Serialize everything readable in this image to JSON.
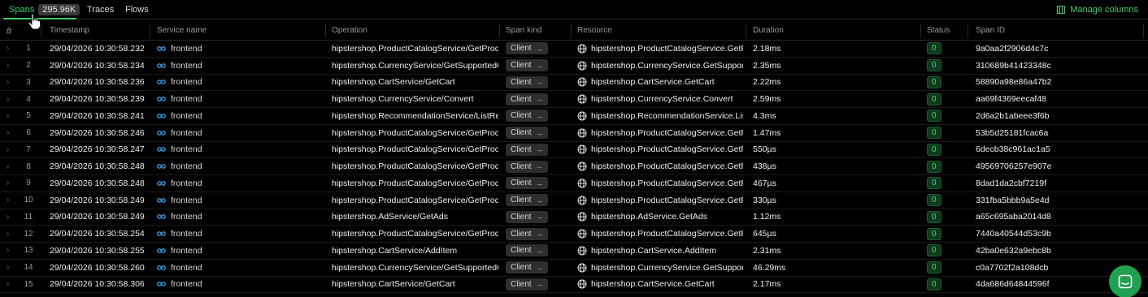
{
  "tabs": [
    {
      "label": "Spans",
      "count": "295.96K",
      "active": true
    },
    {
      "label": "Traces"
    },
    {
      "label": "Flows"
    }
  ],
  "manage_columns": "Manage columns",
  "columns": {
    "num": "#",
    "timestamp": "Timestamp",
    "service": "Service name",
    "operation": "Operation",
    "kind": "Span kind",
    "resource": "Resource",
    "duration": "Duration",
    "status": "Status",
    "span_id": "Span ID"
  },
  "rows": [
    {
      "n": "1",
      "ts": "29/04/2026 10:30:58.232",
      "svc": "frontend",
      "op": "hipstershop.ProductCatalogService/GetProdu…",
      "kind": "Client",
      "res": "hipstershop.ProductCatalogService.GetProd",
      "dur": "2.18ms",
      "status": "0",
      "id": "9a0aa2f2906d4c7c"
    },
    {
      "n": "2",
      "ts": "29/04/2026 10:30:58.234",
      "svc": "frontend",
      "op": "hipstershop.CurrencyService/GetSupportedC…",
      "kind": "Client",
      "res": "hipstershop.CurrencyService.GetSupported",
      "dur": "2.35ms",
      "status": "0",
      "id": "310689b41423348c"
    },
    {
      "n": "3",
      "ts": "29/04/2026 10:30:58.236",
      "svc": "frontend",
      "op": "hipstershop.CartService/GetCart",
      "kind": "Client",
      "res": "hipstershop.CartService.GetCart",
      "dur": "2.22ms",
      "status": "0",
      "id": "58890a98e86a47b2"
    },
    {
      "n": "4",
      "ts": "29/04/2026 10:30:58.239",
      "svc": "frontend",
      "op": "hipstershop.CurrencyService/Convert",
      "kind": "Client",
      "res": "hipstershop.CurrencyService.Convert",
      "dur": "2.59ms",
      "status": "0",
      "id": "aa69f4369eecaf48"
    },
    {
      "n": "5",
      "ts": "29/04/2026 10:30:58.241",
      "svc": "frontend",
      "op": "hipstershop.RecommendationService/ListRec…",
      "kind": "Client",
      "res": "hipstershop.RecommendationService.ListRe",
      "dur": "4.3ms",
      "status": "0",
      "id": "2d6a2b1abeee3f6b"
    },
    {
      "n": "6",
      "ts": "29/04/2026 10:30:58.246",
      "svc": "frontend",
      "op": "hipstershop.ProductCatalogService/GetProdu…",
      "kind": "Client",
      "res": "hipstershop.ProductCatalogService.GetProd",
      "dur": "1.47ms",
      "status": "0",
      "id": "53b5d25181fcac6a"
    },
    {
      "n": "7",
      "ts": "29/04/2026 10:30:58.247",
      "svc": "frontend",
      "op": "hipstershop.ProductCatalogService/GetProdu…",
      "kind": "Client",
      "res": "hipstershop.ProductCatalogService.GetProd",
      "dur": "550µs",
      "status": "0",
      "id": "6decb38c961ac1a5"
    },
    {
      "n": "8",
      "ts": "29/04/2026 10:30:58.248",
      "svc": "frontend",
      "op": "hipstershop.ProductCatalogService/GetProdu…",
      "kind": "Client",
      "res": "hipstershop.ProductCatalogService.GetProd",
      "dur": "438µs",
      "status": "0",
      "id": "49569706257e907e"
    },
    {
      "n": "9",
      "ts": "29/04/2026 10:30:58.248",
      "svc": "frontend",
      "op": "hipstershop.ProductCatalogService/GetProdu…",
      "kind": "Client",
      "res": "hipstershop.ProductCatalogService.GetProd",
      "dur": "467µs",
      "status": "0",
      "id": "8dad1da2cbf7219f"
    },
    {
      "n": "10",
      "ts": "29/04/2026 10:30:58.249",
      "svc": "frontend",
      "op": "hipstershop.ProductCatalogService/GetProdu…",
      "kind": "Client",
      "res": "hipstershop.ProductCatalogService.GetProd",
      "dur": "330µs",
      "status": "0",
      "id": "331fba5bbb9a5e4d"
    },
    {
      "n": "11",
      "ts": "29/04/2026 10:30:58.249",
      "svc": "frontend",
      "op": "hipstershop.AdService/GetAds",
      "kind": "Client",
      "res": "hipstershop.AdService.GetAds",
      "dur": "1.12ms",
      "status": "0",
      "id": "a65c695aba2014d8"
    },
    {
      "n": "12",
      "ts": "29/04/2026 10:30:58.254",
      "svc": "frontend",
      "op": "hipstershop.ProductCatalogService/GetProdu…",
      "kind": "Client",
      "res": "hipstershop.ProductCatalogService.GetProd",
      "dur": "645µs",
      "status": "0",
      "id": "7440a40544d53c9b"
    },
    {
      "n": "13",
      "ts": "29/04/2026 10:30:58.255",
      "svc": "frontend",
      "op": "hipstershop.CartService/AddItem",
      "kind": "Client",
      "res": "hipstershop.CartService.AddItem",
      "dur": "2.31ms",
      "status": "0",
      "id": "42ba0e632a9ebc8b"
    },
    {
      "n": "14",
      "ts": "29/04/2026 10:30:58.260",
      "svc": "frontend",
      "op": "hipstershop.CurrencyService/GetSupportedC…",
      "kind": "Client",
      "res": "hipstershop.CurrencyService.GetSupported",
      "dur": "46.29ms",
      "status": "0",
      "id": "c0a7702f2a108dcb"
    },
    {
      "n": "15",
      "ts": "29/04/2026 10:30:58.306",
      "svc": "frontend",
      "op": "hipstershop.CartService/GetCart",
      "kind": "Client",
      "res": "hipstershop.CartService.GetCart",
      "dur": "2.17ms",
      "status": "0",
      "id": "4da686d64844596f"
    }
  ]
}
